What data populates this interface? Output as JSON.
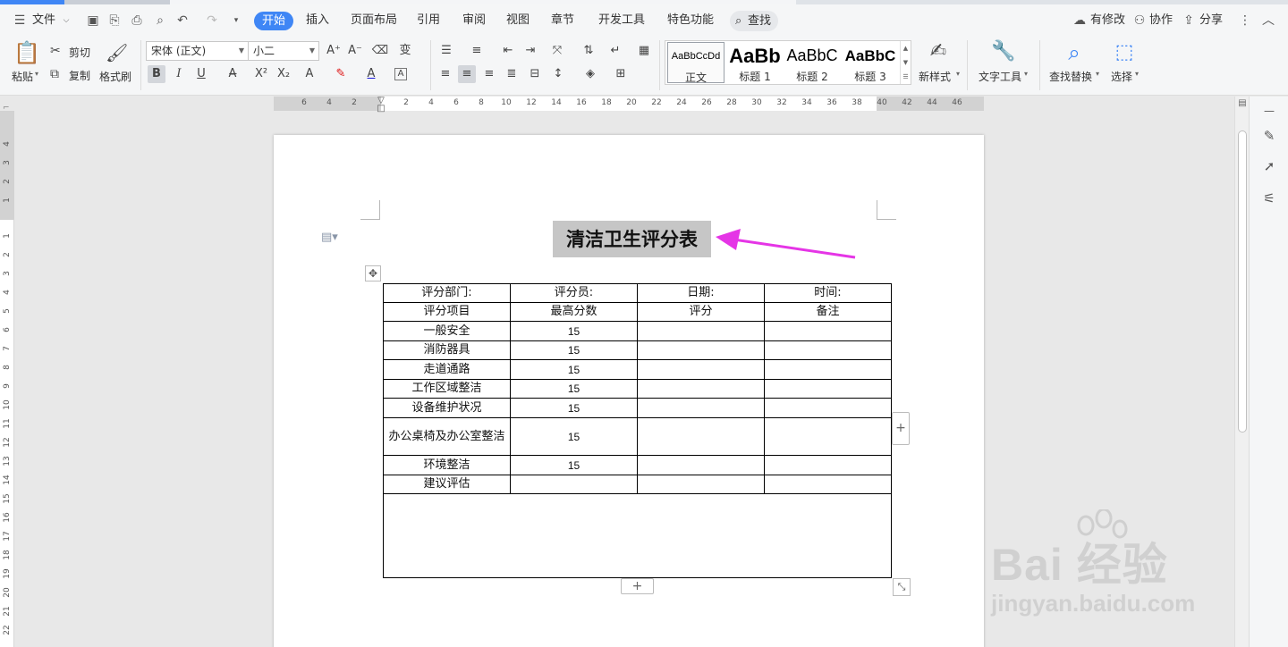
{
  "menubar": {
    "file_label": "文件",
    "tabs": [
      "开始",
      "插入",
      "页面布局",
      "引用",
      "审阅",
      "视图",
      "章节",
      "开发工具",
      "特色功能"
    ],
    "search_label": "查找",
    "right": {
      "changes": "有修改",
      "collab": "协作",
      "share": "分享"
    }
  },
  "ribbon": {
    "paste": "粘贴",
    "cut": "剪切",
    "copy": "复制",
    "format_painter": "格式刷",
    "font_name": "宋体 (正文)",
    "font_size": "小二",
    "styles": [
      {
        "preview": "AaBbCcDd",
        "name": "正文"
      },
      {
        "preview": "AaBb",
        "name": "标题 1"
      },
      {
        "preview": "AaBbC",
        "name": "标题 2"
      },
      {
        "preview": "AaBbC",
        "name": "标题 3"
      }
    ],
    "new_style": "新样式",
    "text_tools": "文字工具",
    "find_replace": "查找替换",
    "select": "选择"
  },
  "hruler_ticks": [
    "6",
    "4",
    "2",
    "2",
    "4",
    "6",
    "8",
    "10",
    "12",
    "14",
    "16",
    "18",
    "20",
    "22",
    "24",
    "26",
    "28",
    "30",
    "32",
    "34",
    "36",
    "38",
    "40",
    "42",
    "44",
    "46"
  ],
  "vruler_ticks": [
    "4",
    "3",
    "2",
    "1",
    "1",
    "2",
    "3",
    "4",
    "5",
    "6",
    "7",
    "8",
    "9",
    "10",
    "11",
    "12",
    "13",
    "14",
    "15",
    "16",
    "17",
    "18",
    "19",
    "20",
    "21",
    "22"
  ],
  "document": {
    "title": "清洁卫生评分表",
    "header_row": [
      "评分部门:",
      "评分员:",
      "日期:",
      "时间:"
    ],
    "column_row": [
      "评分项目",
      "最高分数",
      "评分",
      "备注"
    ],
    "rows": [
      [
        "一般安全",
        "15",
        "",
        ""
      ],
      [
        "消防器具",
        "15",
        "",
        ""
      ],
      [
        "走道通路",
        "15",
        "",
        ""
      ],
      [
        "工作区域整洁",
        "15",
        "",
        ""
      ],
      [
        "设备维护状况",
        "15",
        "",
        ""
      ],
      [
        "办公桌椅及办公室整洁",
        "15",
        "",
        ""
      ],
      [
        "环境整洁",
        "15",
        "",
        ""
      ],
      [
        "建议评估",
        "",
        "",
        ""
      ]
    ]
  },
  "annotation": {
    "arrow_color": "#e535e6"
  },
  "watermark": {
    "brand": "Bai  经验",
    "url": "jingyan.baidu.com"
  },
  "colors": {
    "accent": "#3f86f5",
    "highlight": "#c6c6c6"
  }
}
